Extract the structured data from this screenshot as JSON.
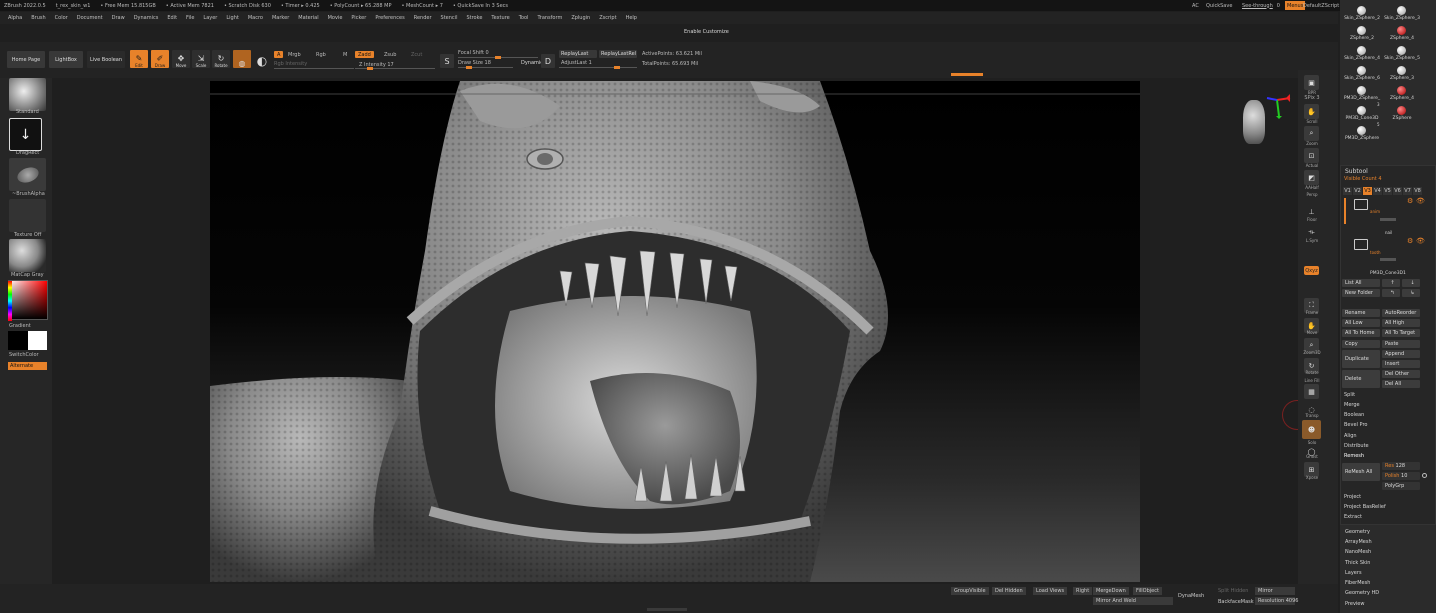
{
  "titlebar": {
    "app": "ZBrush 2022.0.5",
    "file": "t_rex_skin_w1",
    "free_mem": "• Free Mem 15.815GB",
    "active_mem": "• Active Mem 7821",
    "scratch": "• Scratch Disk 630",
    "timer": "• Timer ▸ 0.425",
    "polycount": "• PolyCount ▸ 65.288 MP",
    "meshcount": "• MeshCount ▸ 7",
    "quicksave_info": "• QuickSave In 3 Secs",
    "ac": "AC",
    "quicksave": "QuickSave",
    "seethrough": "See-through",
    "seethrough_val": "0",
    "menus": "Menus",
    "script": "DefaultZScript"
  },
  "menubar": [
    "Alpha",
    "Brush",
    "Color",
    "Document",
    "Draw",
    "Dynamics",
    "Edit",
    "File",
    "Layer",
    "Light",
    "Macro",
    "Marker",
    "Material",
    "Movie",
    "Picker",
    "Preferences",
    "Render",
    "Stencil",
    "Stroke",
    "Texture",
    "Tool",
    "Transform",
    "Zplugin",
    "Zscript",
    "Help"
  ],
  "enable_customize": "Enable Customize",
  "toolbar": {
    "home_page": "Home Page",
    "lightbox": "LightBox",
    "live_boolean": "Live Boolean",
    "edit": "Edit",
    "draw": "Draw",
    "move": "Move",
    "scale": "Scale",
    "rotate": "Rotate",
    "a": "A",
    "mrgb": "Mrgb",
    "rgb": "Rgb",
    "m": "M",
    "zadd": "Zadd",
    "zsub": "Zsub",
    "zcut": "Zcut",
    "rgb_intensity": "Rgb Intensity",
    "z_intensity": "Z Intensity",
    "z_intensity_val": "17",
    "focal_shift": "Focal Shift",
    "focal_shift_val": "0",
    "draw_size": "Draw Size",
    "draw_size_val": "18",
    "dynamic": "Dynamic",
    "replay_last": "ReplayLast",
    "replay_last_rel": "ReplayLastRel",
    "adjust_last": "AdjustLast",
    "adjust_last_val": "1",
    "active_points": "ActivePoints: 63.621 Mil",
    "total_points": "TotalPoints: 65.693 Mil"
  },
  "leftshelf": {
    "standard": "Standard",
    "dragrect": "DragRect",
    "brushalpha": "~BrushAlpha",
    "texture_off": "Texture Off",
    "matcap": "MatCap Gray",
    "gradient": "Gradient",
    "switchcolor": "SwitchColor",
    "alternate": "Alternate"
  },
  "rightshelf": {
    "bpr": "BPR",
    "spix": "SPix",
    "spix_val": "3",
    "scroll": "Scroll",
    "zoom": "Zoom",
    "actual": "Actual",
    "aahalf": "AAHalf",
    "persp": "Persp",
    "floor": "Floor",
    "lsym": "L.Sym",
    "xyz": "Qxyz",
    "frame": "Frame",
    "move": "Move",
    "zoom3d": "Zoom3D",
    "rotate": "Rotate",
    "linefill": "Line Fill",
    "polyf": "PolyF",
    "transp": "Transp",
    "ghost": "Ghost",
    "solo": "Solo",
    "xpose": "Xpose"
  },
  "panel": {
    "tools": [
      {
        "name": "Skin_ZSphere_2"
      },
      {
        "name": "Skin_ZSphere_3"
      },
      {
        "name": "ZSphere_2"
      },
      {
        "name": "ZSphere_4"
      },
      {
        "name": "Skin_ZSphere_4"
      },
      {
        "name": "Skin_ZSphere_5"
      },
      {
        "name": "Skin_ZSphere_6"
      },
      {
        "name": "ZSphere_3"
      },
      {
        "name": "PM3D_ZSphere_"
      },
      {
        "name": "ZSphere_4"
      },
      {
        "name": "PM3D_Cone3D"
      },
      {
        "name": "ZSphere"
      },
      {
        "name": "PM3D_ZSphere"
      }
    ],
    "count_3": "3",
    "count_5": "5",
    "subtool": "Subtool",
    "visible_count": "Visible Count",
    "visible_count_val": "4",
    "versions": [
      "V1",
      "V2",
      "V3",
      "V4",
      "V5",
      "V6",
      "V7",
      "V8"
    ],
    "anim": "anim",
    "nail": "nail",
    "tooth": "tooth",
    "cone": "PM3D_Cone3D1",
    "list_all": "List All",
    "new_folder": "New Folder",
    "rename": "Rename",
    "autoreorder": "AutoReorder",
    "all_low": "All Low",
    "all_high": "All High",
    "all_to_home": "All To Home",
    "all_to_target": "All To Target",
    "copy": "Copy",
    "paste": "Paste",
    "duplicate": "Duplicate",
    "append": "Append",
    "insert": "Insert",
    "delete": "Delete",
    "del_other": "Del Other",
    "del_all": "Del All",
    "split": "Split",
    "merge": "Merge",
    "boolean": "Boolean",
    "bevel_pro": "Bevel Pro",
    "align": "Align",
    "distribute": "Distribute",
    "remesh": "Remesh",
    "remesh_all": "ReMesh All",
    "res": "Res",
    "res_val": "128",
    "polish": "Polish",
    "polish_val": "10",
    "polygrp": "PolyGrp",
    "project": "Project",
    "project_basrelief": "Project BasRelief",
    "extract": "Extract",
    "geometry": "Geometry",
    "arraymesh": "ArrayMesh",
    "nanomesh": "NanoMesh",
    "thick_skin": "Thick Skin",
    "layers": "Layers",
    "fibermesh": "FiberMesh",
    "geometry_hd": "Geometry HD",
    "preview": "Preview"
  },
  "bottombar": {
    "groupsvisible": "GroupVisible",
    "del_hidden": "Del Hidden",
    "load_views": "Load Views",
    "right": "Right",
    "mergedown": "MergeDown",
    "fillobject": "FillObject",
    "mirror_and_weld": "Mirror And Weld",
    "dynamesh": "DynaMesh",
    "split_hidden": "Split Hidden",
    "mirror": "Mirror",
    "backfacemask": "BackfaceMask",
    "resolution": "Resolution",
    "resolution_val": "4096"
  },
  "colors": {
    "accent": "#e8822a",
    "bg": "#1f1f1f",
    "panel": "#2b2b2b"
  }
}
